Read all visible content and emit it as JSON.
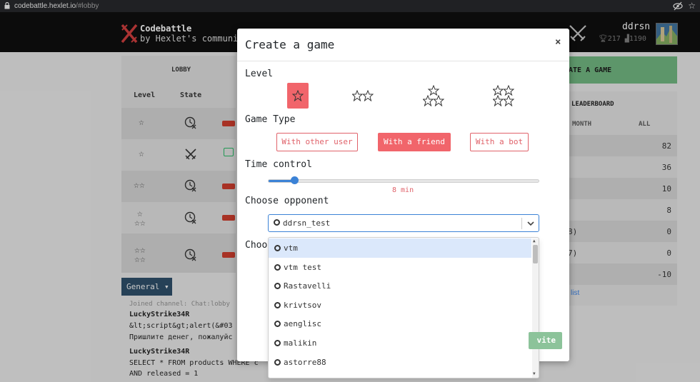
{
  "browser": {
    "url_host": "codebattle.hexlet.io",
    "url_path": "/#lobby"
  },
  "header": {
    "logo_title": "Codebattle",
    "logo_subtitle": "by Hexlet's communi",
    "username": "ddrsn",
    "rating": "217",
    "games": "1190"
  },
  "lobby": {
    "tab_label": "LOBBY",
    "col_level": "Level",
    "col_state": "State",
    "rows": [
      {
        "stars": "☆",
        "state": "waiting"
      },
      {
        "stars": "☆",
        "state": "playing"
      },
      {
        "stars": "☆☆",
        "state": "waiting"
      },
      {
        "stars": "☆\n☆☆",
        "state": "waiting"
      },
      {
        "stars": "☆☆\n☆☆",
        "state": "waiting"
      }
    ]
  },
  "create_game_button": "ATE A GAME",
  "leaderboard": {
    "title": "LEADERBOARD",
    "col_month": "MONTH",
    "col_all": "ALL",
    "rows": [
      {
        "frag": "",
        "score": "82"
      },
      {
        "frag": "",
        "score": "36"
      },
      {
        "frag": "",
        "score": "10"
      },
      {
        "frag": "",
        "score": "8"
      },
      {
        "frag": "8)",
        "score": "0"
      },
      {
        "frag": "7)",
        "score": "0"
      },
      {
        "frag": "",
        "score": "-10"
      }
    ],
    "link": "list"
  },
  "chat": {
    "tab_label": "General",
    "lines": [
      {
        "type": "sys",
        "text": "Joined channel: Chat:lobby"
      },
      {
        "type": "nick",
        "text": "LuckyStrike34R"
      },
      {
        "type": "msg",
        "text": "&lt;script&gt;alert(&#03"
      },
      {
        "type": "msg",
        "text": "Пришлите денег, пожалуйс"
      },
      {
        "type": "nick",
        "text": "LuckyStrike34R"
      },
      {
        "type": "msg",
        "text": "SELECT * FROM products WHERE c"
      },
      {
        "type": "msg",
        "text": "AND released = 1"
      }
    ]
  },
  "invite_button_fragment": "vite",
  "modal": {
    "title": "Create a game",
    "close": "×",
    "level_label": "Level",
    "levels": [
      {
        "name": "elementary",
        "stars": 1,
        "active": true
      },
      {
        "name": "easy",
        "stars": 2,
        "active": false
      },
      {
        "name": "medium",
        "stars": 3,
        "active": false
      },
      {
        "name": "hard",
        "stars": 4,
        "active": false
      }
    ],
    "game_type_label": "Game Type",
    "game_types": [
      {
        "label": "With other user",
        "active": false
      },
      {
        "label": "With a friend",
        "active": true
      },
      {
        "label": "With a bot",
        "active": false
      }
    ],
    "time_control_label": "Time control",
    "time_value_fraction": 0.09,
    "time_value_text": "8 min",
    "opponent_label": "Choose opponent",
    "opponent_selected": "ddrsn_test",
    "hidden_label_fragment": "Choo",
    "opponent_options": [
      "vtm",
      "vtm test",
      "Rastavelli",
      "krivtsov",
      "aenglisc",
      "malikin",
      "astorre88"
    ]
  },
  "colors": {
    "accent_red": "#f1656b",
    "accent_blue": "#3b82d6",
    "header_bg": "#0e0e0e",
    "create_green": "#6aab79"
  }
}
